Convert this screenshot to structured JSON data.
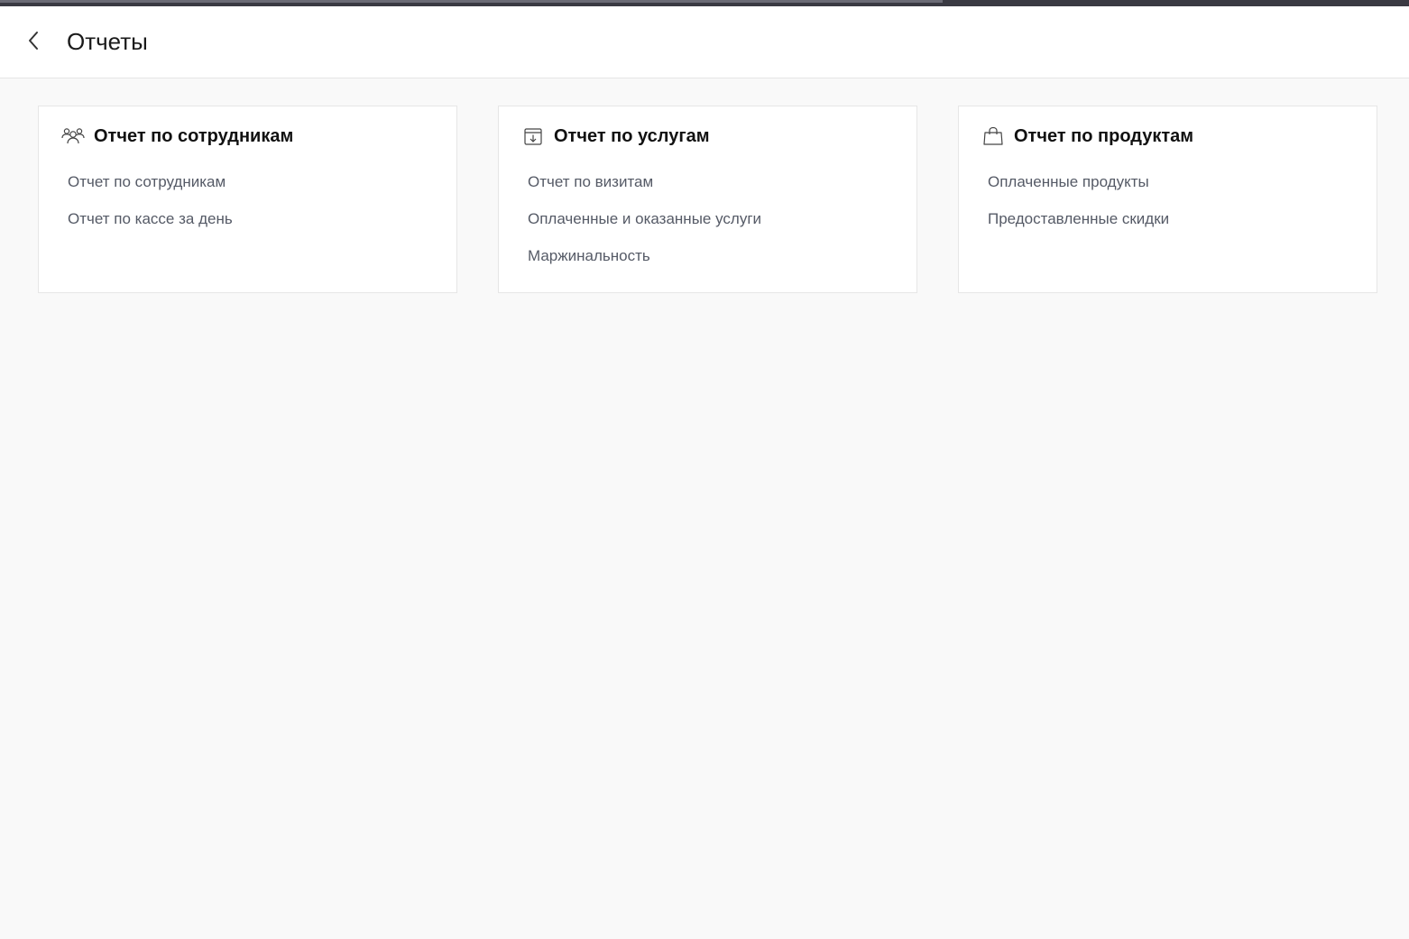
{
  "header": {
    "title": "Отчеты",
    "back_icon": "chevron-left-icon"
  },
  "cards": [
    {
      "icon": "users-icon",
      "title": "Отчет по сотрудникам",
      "links": [
        "Отчет по сотрудникам",
        "Отчет по кассе за день"
      ]
    },
    {
      "icon": "box-download-icon",
      "title": "Отчет по услугам",
      "links": [
        "Отчет по визитам",
        "Оплаченные и оказанные услуги",
        "Маржинальность"
      ]
    },
    {
      "icon": "shopping-bag-icon",
      "title": "Отчет по продуктам",
      "links": [
        "Оплаченные продукты",
        "Предоставленные скидки"
      ]
    }
  ],
  "colors": {
    "background": "#f9f9f9",
    "card": "#ffffff",
    "link_text": "#555a66",
    "title_text": "#111111"
  }
}
